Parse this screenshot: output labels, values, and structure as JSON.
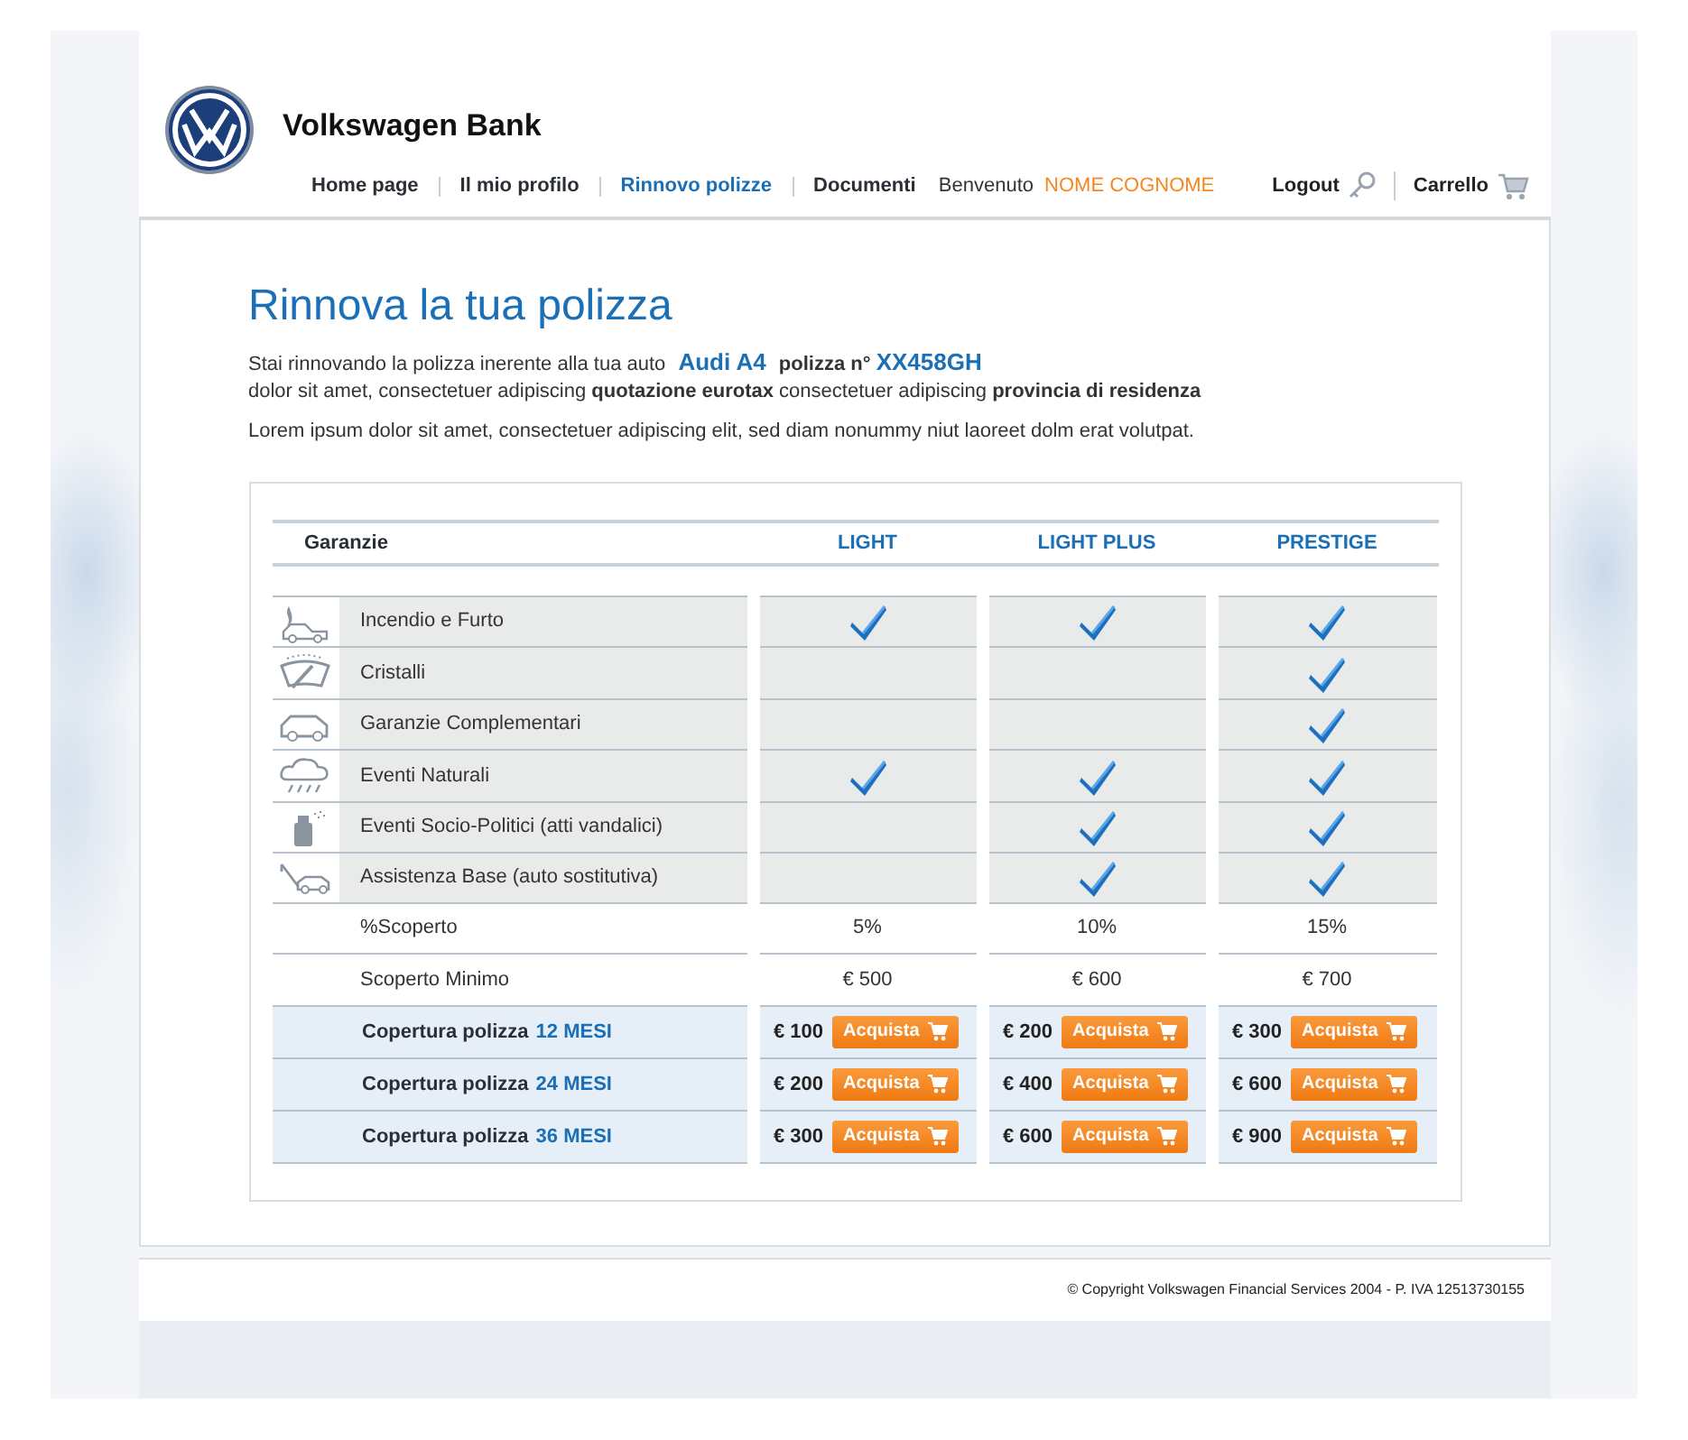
{
  "brand": {
    "name": "Volkswagen Bank"
  },
  "nav": [
    {
      "label": "Home page",
      "selected": false
    },
    {
      "label": "Il mio profilo",
      "selected": false
    },
    {
      "label": "Rinnovo polizze",
      "selected": true
    },
    {
      "label": "Documenti",
      "selected": false
    }
  ],
  "user": {
    "greeting": "Benvenuto",
    "name": "NOME COGNOME"
  },
  "actions": [
    {
      "label": "Logout",
      "kind": "key"
    },
    {
      "label": "Carrello",
      "kind": "cart"
    }
  ],
  "title": "Rinnova la tua polizza",
  "intro": [
    "Stai rinnovando la polizza inerente alla tua auto **Audi A4** **polizza n°** **XX458GH**",
    "dolor sit amet, consectetuer adipiscing **quotazione eurotax** consectetuer adipiscing **provincia di residenza**"
  ],
  "lead": "Lorem ipsum dolor sit amet, consectetuer adipiscing elit, sed diam nonummy niut laoreet dolm erat volutpat.",
  "table": {
    "heading": "Garanzie",
    "plans": [
      "LIGHT",
      "LIGHT PLUS",
      "PRESTIGE"
    ],
    "guarantees": [
      {
        "kind": "fire",
        "label": "Incendio e Furto",
        "included": [
          true,
          true,
          true
        ]
      },
      {
        "kind": "windshield",
        "label": "Cristalli",
        "included": [
          false,
          false,
          true
        ]
      },
      {
        "kind": "car",
        "label": "Garanzie Complementari",
        "included": [
          false,
          false,
          true
        ]
      },
      {
        "kind": "storm",
        "label": "Eventi Naturali",
        "included": [
          true,
          true,
          true
        ]
      },
      {
        "kind": "spray",
        "label": "Eventi Socio-Politici (atti vandalici)",
        "included": [
          false,
          true,
          true
        ]
      },
      {
        "kind": "tow",
        "label": "Assistenza Base (auto sostitutiva)",
        "included": [
          false,
          true,
          true
        ]
      }
    ],
    "values": [
      {
        "label": "%Scoperto",
        "cells": [
          "5%",
          "10%",
          "15%"
        ]
      },
      {
        "label": "Scoperto Minimo",
        "cells": [
          "€ 500",
          "€ 600",
          "€ 700"
        ]
      }
    ],
    "offers": [
      {
        "label": "Copertura polizza",
        "duration": "12 MESI",
        "prices": [
          {
            "price": "€ 100",
            "button": "Acquista"
          },
          {
            "price": "€ 200",
            "button": "Acquista"
          },
          {
            "price": "€ 300",
            "button": "Acquista"
          }
        ]
      },
      {
        "label": "Copertura polizza",
        "duration": "24 MESI",
        "prices": [
          {
            "price": "€ 200",
            "button": "Acquista"
          },
          {
            "price": "€ 400",
            "button": "Acquista"
          },
          {
            "price": "€ 600",
            "button": "Acquista"
          }
        ]
      },
      {
        "label": "Copertura polizza",
        "duration": "36 MESI",
        "prices": [
          {
            "price": "€ 300",
            "button": "Acquista"
          },
          {
            "price": "€ 600",
            "button": "Acquista"
          },
          {
            "price": "€ 900",
            "button": "Acquista"
          }
        ]
      }
    ]
  },
  "footer": "© Copyright Volkswagen Financial Services 2004 - P. IVA 12513730155"
}
